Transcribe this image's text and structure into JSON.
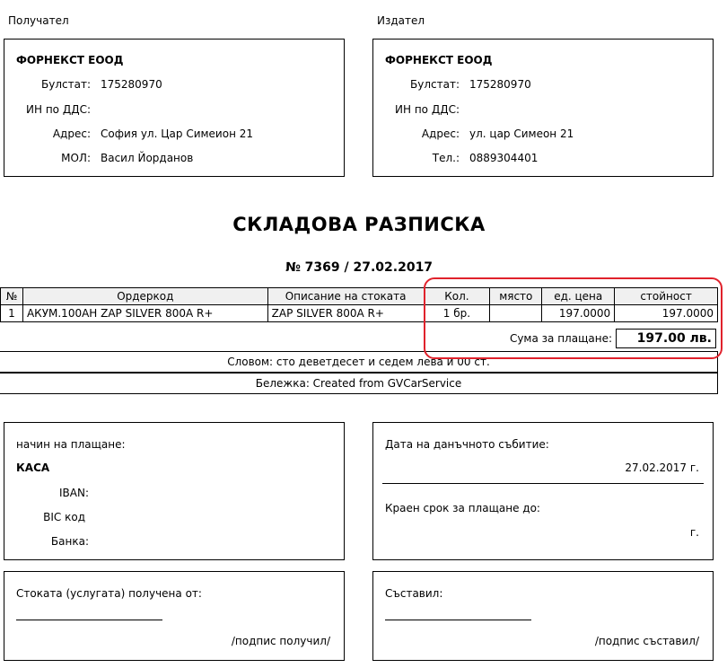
{
  "recipient": {
    "heading": "Получател",
    "name": "ФОРНЕКСТ ЕООД",
    "bulstat_label": "Булстат:",
    "bulstat": "175280970",
    "vat_label": "ИН по ДДС:",
    "vat": "",
    "address_label": "Адрес:",
    "address": "София ул. Цар Симеион 21",
    "mol_label": "МОЛ:",
    "mol": "Васил Йорданов"
  },
  "issuer": {
    "heading": "Издател",
    "name": "ФОРНЕКСТ ЕООД",
    "bulstat_label": "Булстат:",
    "bulstat": "175280970",
    "vat_label": "ИН по ДДС:",
    "vat": "",
    "address_label": "Адрес:",
    "address": "ул. цар Симеон 21",
    "phone_label": "Тел.:",
    "phone": "0889304401"
  },
  "document": {
    "title": "СКЛАДОВА РАЗПИСКА",
    "number_line": "№ 7369 / 27.02.2017"
  },
  "table": {
    "headers": [
      "№",
      "Ордеркод",
      "Описание на стоката",
      "Кол.",
      "място",
      "ед. цена",
      "стойност"
    ],
    "rows": [
      [
        "1",
        "АКУМ.100АН ZAP SILVER 800A R+",
        "ZAP SILVER 800A R+",
        "1 бр.",
        "",
        "197.0000",
        "197.0000"
      ]
    ],
    "sum_label": "Сума за плащане:",
    "sum_value": "197.00 лв."
  },
  "in_words": "Словом: сто деветдесет и седем лева и 00 ст.",
  "note": "Бележка: Created from GVCarService",
  "payment": {
    "method_label": "начин на плащане:",
    "method": "КАСА",
    "iban_label": "IBAN:",
    "bic_label": "BIC код",
    "bank_label": "Банка:"
  },
  "tax_event": {
    "date_label": "Дата на данъчното събитие:",
    "date_value": "27.02.2017 г.",
    "deadline_label": "Краен срок за плащане до:",
    "deadline_value": "г."
  },
  "received": {
    "label": "Стоката (услугата) получена от:",
    "sign": "/подпис получил/"
  },
  "composed": {
    "label": "Съставил:",
    "sign": "/подпис съставил/"
  },
  "colors": {
    "highlight": "#e0222c",
    "header_bg": "#f0f0f0"
  }
}
